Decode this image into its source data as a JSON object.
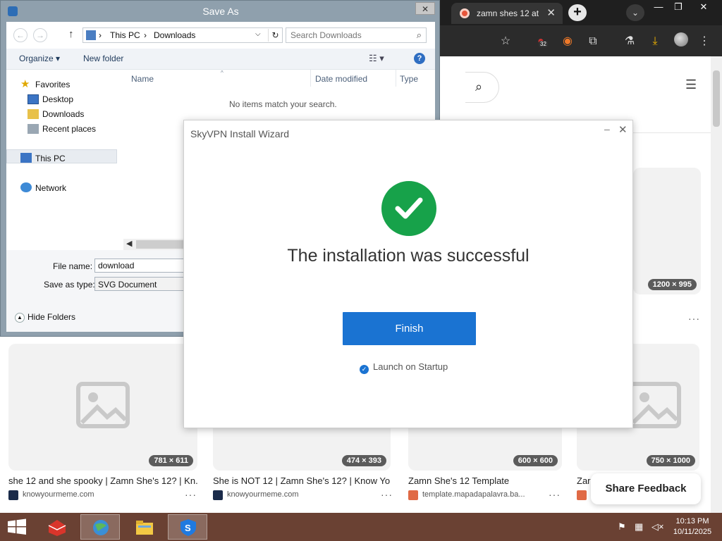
{
  "browser": {
    "tab_title": "zamn shes 12 at",
    "tab_close": "✕",
    "new_tab": "+",
    "tab_search": "⌄",
    "window_minimize": "—",
    "window_restore": "❐",
    "window_close": "✕",
    "extension_badge": "32",
    "toolbar_menu": "⋮",
    "page_menu": "☰"
  },
  "cards": [
    {
      "dimensions": "1200 × 995"
    },
    {
      "dimensions": "781 × 611",
      "title": "she 12 and she spooky | Zamn She's 12? | Kn...",
      "source": "knowyourmeme.com"
    },
    {
      "dimensions": "474 × 393",
      "title": "She is NOT 12 | Zamn She's 12? | Know Yo...",
      "source": "knowyourmeme.com"
    },
    {
      "dimensions": "600 × 600",
      "title": "Zamn She's 12 Template",
      "source": "template.mapadapalavra.ba..."
    },
    {
      "dimensions": "750 × 1000",
      "title": "Zar",
      "source": ""
    }
  ],
  "card_more": "···",
  "share_feedback": "Share Feedback",
  "save_as": {
    "title": "Save As",
    "close": "✕",
    "path": [
      "This PC",
      "Downloads"
    ],
    "path_sep": "›",
    "search_placeholder": "Search Downloads",
    "organize": "Organize ▾",
    "new_folder": "New folder",
    "view_icon": "☷ ▾",
    "help_icon": "?",
    "nav": {
      "favorites": "Favorites",
      "desktop": "Desktop",
      "downloads": "Downloads",
      "recent": "Recent places",
      "this_pc": "This PC",
      "network": "Network"
    },
    "columns": {
      "name": "Name",
      "date": "Date modified",
      "type": "Type"
    },
    "empty_message": "No items match your search.",
    "file_name_label": "File name:",
    "file_name_value": "download",
    "save_type_label": "Save as type:",
    "save_type_value": "SVG Document",
    "hide_folders": "Hide Folders"
  },
  "wizard": {
    "title": "SkyVPN Install Wizard",
    "minimize": "–",
    "close": "✕",
    "message": "The installation was successful",
    "finish_button": "Finish",
    "launch_on_startup": "Launch on Startup",
    "launch_checked": true,
    "accent_color": "#1a73d2",
    "success_color": "#17a24a"
  },
  "taskbar": {
    "time": "10:13 PM",
    "date": "10/11/2025"
  }
}
